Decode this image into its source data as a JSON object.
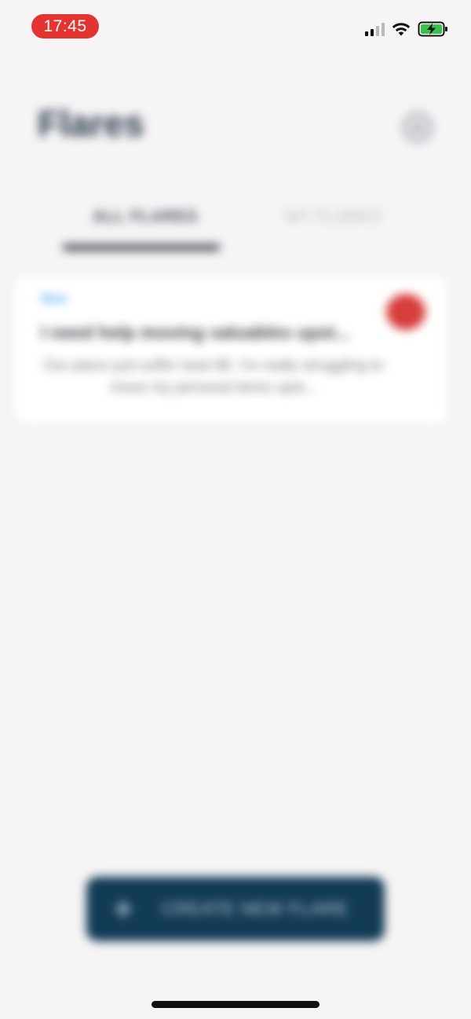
{
  "status_bar": {
    "time": "17:45",
    "time_pill_color": "#e3342f",
    "signal_icon": "cellular-signal-icon",
    "wifi_icon": "wifi-icon",
    "battery_icon": "battery-charging-icon"
  },
  "header": {
    "title": "Flares",
    "settings_icon": "gear-icon"
  },
  "tabs": [
    {
      "label": "All Flares",
      "active": true
    },
    {
      "label": "My Flares",
      "active": false
    }
  ],
  "flares": [
    {
      "badge": "New",
      "title": "I need help moving valuables upst...",
      "body": "Our place just suffer heat 88. I'm really struggling to move my personal items upst...",
      "status_color": "#d73d3a"
    }
  ],
  "create_button": {
    "label": "Create New Flare",
    "icon": "plus-icon",
    "color": "#123b55"
  }
}
